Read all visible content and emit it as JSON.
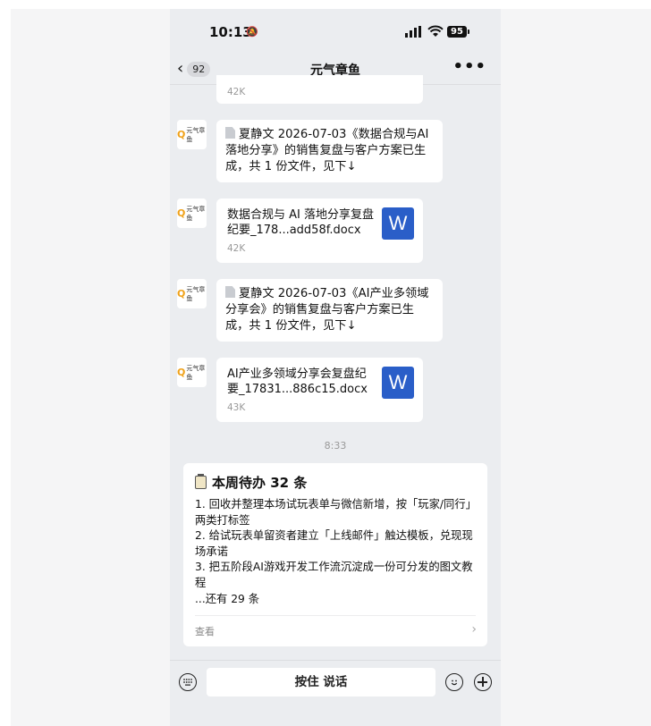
{
  "status_bar": {
    "time": "10:13",
    "battery": "95"
  },
  "nav": {
    "unread_count": "92",
    "title": "元气章鱼",
    "more": "•••"
  },
  "avatar_logo": "元气章鱼",
  "messages": [
    {
      "type": "file",
      "size": "42K"
    },
    {
      "type": "text",
      "text": "夏静文 2026-07-03《数据合规与AI落地分享》的销售复盘与客户方案已生成，共 1 份文件，见下↓"
    },
    {
      "type": "file",
      "name": "数据合规与 AI 落地分享复盘纪要_178...add58f.docx",
      "size": "42K"
    },
    {
      "type": "text",
      "text": "夏静文 2026-07-03《AI产业多领域分享会》的销售复盘与客户方案已生成，共 1 份文件，见下↓"
    },
    {
      "type": "file",
      "name": "AI产业多领域分享会复盘纪要_17831...886c15.docx",
      "size": "43K"
    }
  ],
  "timestamp": "8:33",
  "todo_card": {
    "title": "本周待办 32 条",
    "items": [
      "1. 回收并整理本场试玩表单与微信新增，按「玩家/同行」两类打标签",
      "2. 给试玩表单留资者建立「上线邮件」触达模板，兑现现场承诺",
      "3. 把五阶段AI游戏开发工作流沉淀成一份可分发的图文教程"
    ],
    "more": "...还有 29 条",
    "view_label": "查看"
  },
  "input_bar": {
    "hold_to_talk": "按住 说话"
  },
  "icons": {
    "back": "chevron-left-icon",
    "more": "more-dots-icon",
    "word": "word-document-icon",
    "keyboard": "keyboard-icon",
    "emoji": "emoji-icon",
    "plus": "plus-icon"
  },
  "colors": {
    "word_blue": "#2a5ec8",
    "chat_bg": "#ebedf0",
    "logo_orange": "#f0a21a"
  }
}
